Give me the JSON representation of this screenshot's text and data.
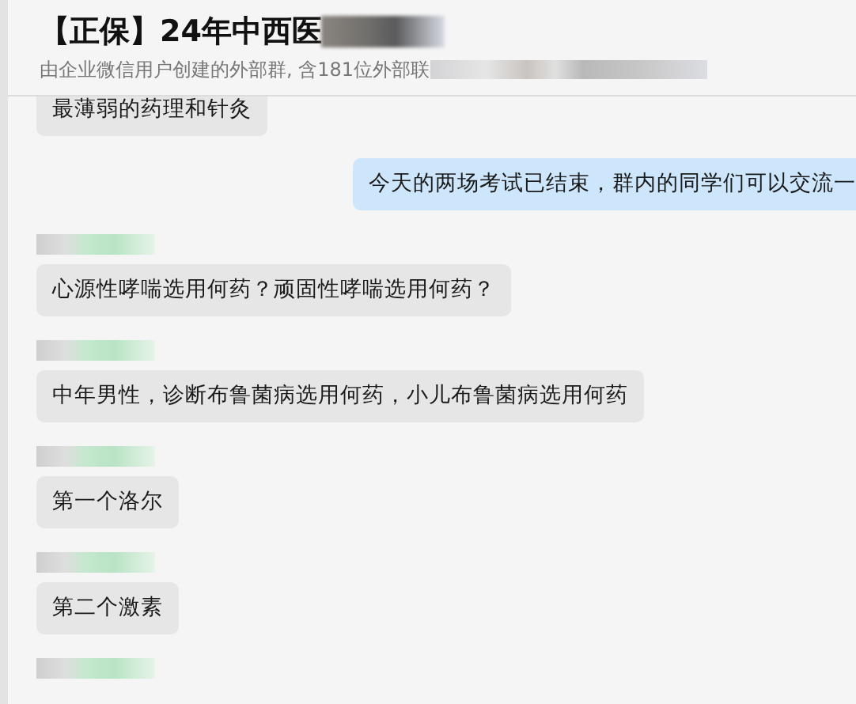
{
  "header": {
    "title": "【正保】24年中西医",
    "title_obscured": true,
    "subtitle": "由企业微信用户创建的外部群, 含181位外部联",
    "subtitle_obscured": true
  },
  "messages": [
    {
      "kind": "incoming",
      "text": "最薄弱的药理和针灸"
    },
    {
      "kind": "outgoing",
      "text": "今天的两场考试已结束，群内的同学们可以交流一"
    },
    {
      "kind": "incoming",
      "sender_obscured": true,
      "text": "心源性哮喘选用何药？顽固性哮喘选用何药？"
    },
    {
      "kind": "incoming",
      "sender_obscured": true,
      "text": "中年男性，诊断布鲁菌病选用何药，小儿布鲁菌病选用何药"
    },
    {
      "kind": "incoming",
      "sender_obscured": true,
      "text": "第一个洛尔"
    },
    {
      "kind": "incoming",
      "sender_obscured": true,
      "text": "第二个激素"
    },
    {
      "kind": "incoming",
      "sender_obscured": true
    }
  ]
}
